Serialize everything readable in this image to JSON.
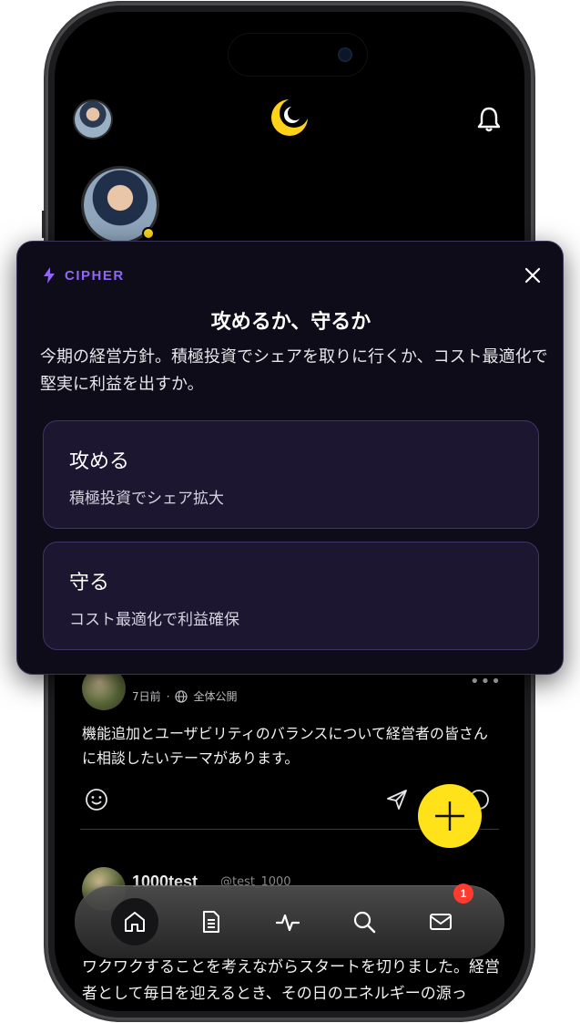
{
  "header": {
    "bell": "bell-icon"
  },
  "modal": {
    "tag": "CIPHER",
    "title": "攻めるか、守るか",
    "description": "今期の経営方針。積極投資でシェアを取りに行くか、コスト最適化で堅実に利益を出すか。",
    "options": [
      {
        "title": "攻める",
        "subtitle": "積極投資でシェア拡大"
      },
      {
        "title": "守る",
        "subtitle": "コスト最適化で利益確保"
      }
    ]
  },
  "posts": [
    {
      "time": "7日前",
      "visibility": "全体公開",
      "body": "機能追加とユーザビリティのバランスについて経営者の皆さんに相談したいテーマがあります。"
    },
    {
      "name": "1000test",
      "handle": "@test_1000",
      "body": "ワクワクすることを考えながらスタートを切りました。経営者として毎日を迎えるとき、その日のエネルギーの源っ"
    }
  ],
  "nav": {
    "items": [
      "home-icon",
      "document-icon",
      "activity-icon",
      "search-icon",
      "mail-icon"
    ],
    "mail_badge": "1"
  },
  "colors": {
    "accent_purple": "#8f66f5",
    "accent_yellow": "#ffe21a",
    "badge_red": "#ff3b30",
    "modal_bg": "#0e0c18",
    "option_bg": "#1c1630"
  }
}
